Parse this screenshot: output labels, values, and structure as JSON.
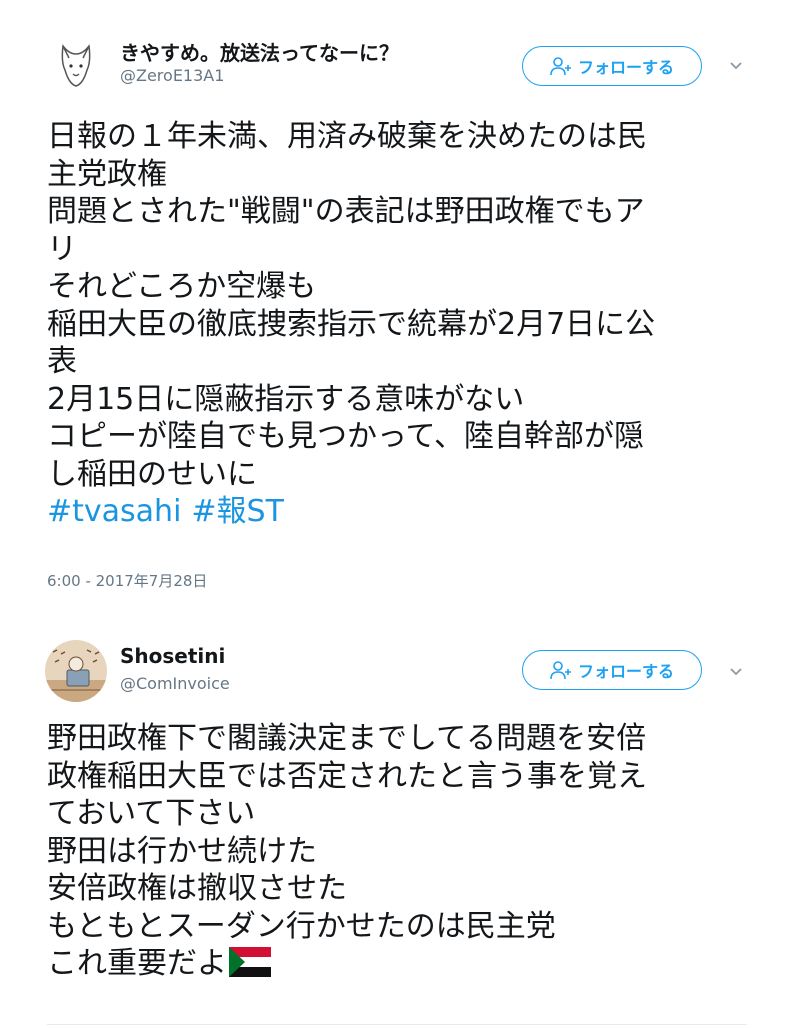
{
  "tweets": [
    {
      "display_name": "きやすめ。放送法ってなーに？",
      "handle": "@ZeroE13A1",
      "follow_label": "フォローする",
      "lines": [
        "日報の１年未満、用済み破棄を決めたのは民",
        "主党政権",
        "問題とされた\"戦闘\"の表記は野田政権でもア",
        "リ",
        "それどころか空爆も",
        "稲田大臣の徹底捜索指示で統幕が2月7日に公",
        "表",
        "2月15日に隠蔽指示する意味がない",
        "コピーが陸自でも見つかって、陸自幹部が隠",
        "し稲田のせいに"
      ],
      "hashtags": [
        "#tvasahi",
        "#報ST"
      ],
      "timestamp": "6:00 - 2017年7月28日"
    },
    {
      "display_name": "Shosetini",
      "handle": "@ComInvoice",
      "follow_label": "フォローする",
      "lines": [
        "野田政権下で閣議決定までしてる問題を安倍",
        "政権稲田大臣では否定されたと言う事を覚え",
        "ておいて下さい",
        "野田は行かせ続けた",
        "安倍政権は撤収させた",
        "もともとスーダン行かせたのは民主党",
        "これ重要だよ"
      ],
      "emoji": "sudan-flag"
    }
  ],
  "colors": {
    "accent": "#1da1f2",
    "link": "#1b95e0",
    "muted": "#657786",
    "text": "#14171a"
  }
}
